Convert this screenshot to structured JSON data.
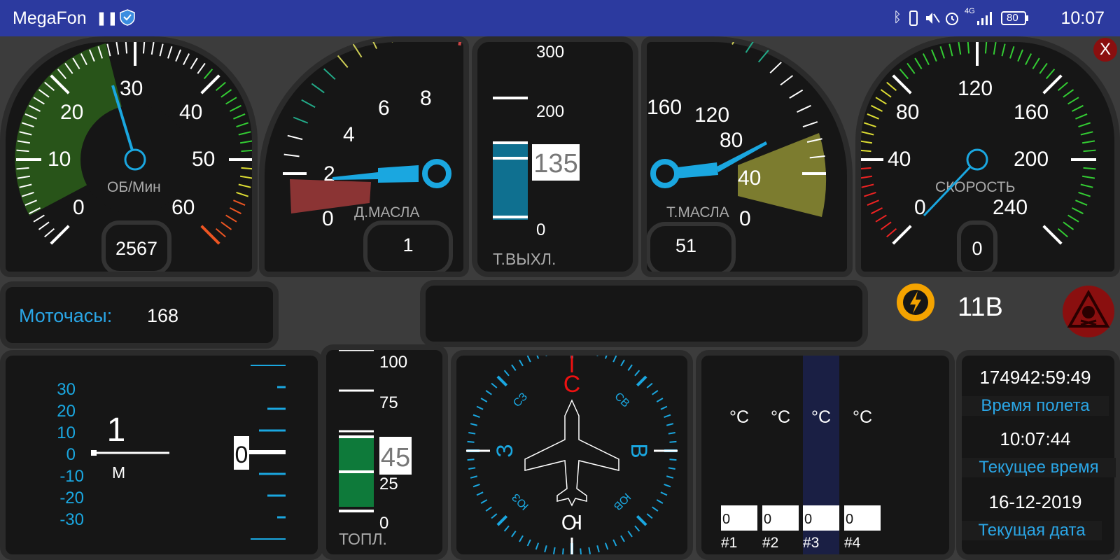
{
  "status_bar": {
    "carrier": "MegaFon",
    "battery": "80",
    "network": "4G",
    "time": "10:07"
  },
  "close_label": "X",
  "gauges": {
    "rpm": {
      "label": "ОБ/Мин",
      "ticks": [
        "0",
        "10",
        "20",
        "30",
        "40",
        "50",
        "60"
      ],
      "readout": "2567",
      "value": 25.67
    },
    "oil_pressure": {
      "label": "Д.МАСЛА",
      "ticks": [
        "0",
        "2",
        "4",
        "6",
        "8"
      ],
      "readout": "1",
      "value": 1
    },
    "exhaust_temp": {
      "label": "Т.ВЫХЛ.",
      "ticks": [
        "300",
        "200",
        "0"
      ],
      "value_display": "135",
      "value": 135
    },
    "oil_temp": {
      "label": "Т.МАСЛА",
      "ticks": [
        "160",
        "120",
        "80",
        "40",
        "0"
      ],
      "readout": "51",
      "value": 51
    },
    "speed": {
      "label": "СКОРОСТЬ",
      "ticks": [
        "0",
        "40",
        "80",
        "120",
        "160",
        "200",
        "240"
      ],
      "readout": "0",
      "value": 0
    }
  },
  "engine_hours": {
    "label": "Моточасы:",
    "value": "168"
  },
  "voltage": "11В",
  "altimeter": {
    "scale": [
      "30",
      "20",
      "10",
      "0",
      "-10",
      "-20",
      "-30"
    ],
    "value": "1",
    "unit": "М",
    "vsi_value": "0"
  },
  "fuel": {
    "label": "ТОПЛ.",
    "ticks": [
      "100",
      "75",
      "25",
      "0"
    ],
    "value_display": "45",
    "value": 45
  },
  "compass": {
    "north": "С",
    "south": "Ю",
    "west": "З",
    "east": "В",
    "nw": "СЗ",
    "ne": "СВ",
    "sw": "ЮЗ",
    "se": "ЮВ"
  },
  "cylinders": {
    "unit": "°С",
    "items": [
      {
        "name": "#1",
        "value": "0"
      },
      {
        "name": "#2",
        "value": "0"
      },
      {
        "name": "#3",
        "value": "0"
      },
      {
        "name": "#4",
        "value": "0"
      }
    ]
  },
  "info": {
    "flight_time": "174942:59:49",
    "flight_time_label": "Время полета",
    "current_time": "10:07:44",
    "current_time_label": "Текущее время",
    "current_date": "16-12-2019",
    "current_date_label": "Текущая дата"
  }
}
